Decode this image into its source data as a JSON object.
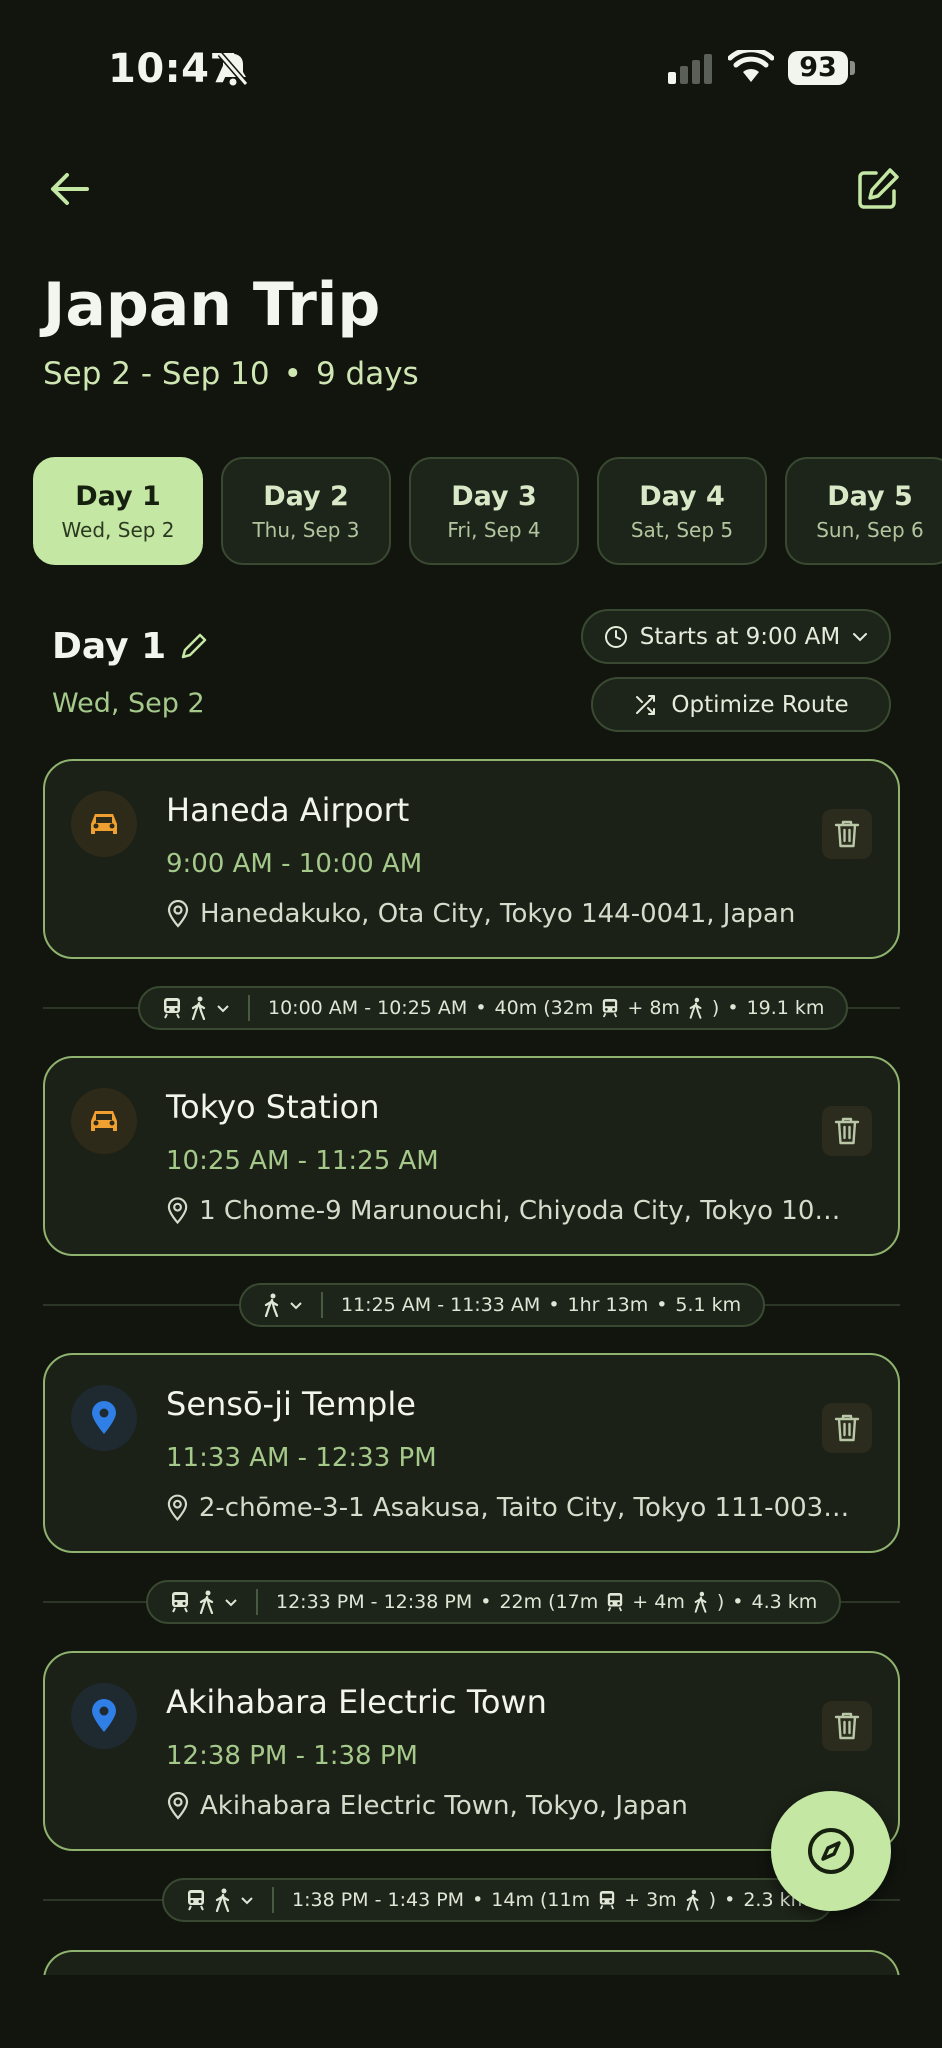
{
  "status_bar": {
    "time": "10:47",
    "battery": "93"
  },
  "trip": {
    "title": "Japan Trip",
    "date_range": "Sep 2 - Sep 10",
    "separator": "•",
    "duration": "9 days"
  },
  "day_tabs": [
    {
      "label": "Day 1",
      "date": "Wed, Sep 2"
    },
    {
      "label": "Day 2",
      "date": "Thu, Sep 3"
    },
    {
      "label": "Day 3",
      "date": "Fri, Sep 4"
    },
    {
      "label": "Day 4",
      "date": "Sat, Sep 5"
    },
    {
      "label": "Day 5",
      "date": "Sun, Sep 6"
    }
  ],
  "day": {
    "title": "Day 1",
    "date": "Wed, Sep 2",
    "starts_label": "Starts at 9:00 AM",
    "optimize_label": "Optimize Route"
  },
  "stops": [
    {
      "name": "Haneda Airport",
      "time": "9:00 AM - 10:00 AM",
      "address": "Hanedakuko, Ota City, Tokyo 144-0041, Japan",
      "icon": "car-icon"
    },
    {
      "name": "Tokyo Station",
      "time": "10:25 AM - 11:25 AM",
      "address": "1 Chome-9 Marunouchi, Chiyoda City, Tokyo 100-0...",
      "icon": "car-icon"
    },
    {
      "name": "Sensō-ji Temple",
      "time": "11:33 AM - 12:33 PM",
      "address": "2-chōme-3-1 Asakusa, Taito City, Tokyo 111-0032, J...",
      "icon": "location-pin-icon"
    },
    {
      "name": "Akihabara Electric Town",
      "time": "12:38 PM - 1:38 PM",
      "address": "Akihabara Electric Town, Tokyo, Japan",
      "icon": "location-pin-icon"
    }
  ],
  "connectors": [
    {
      "time": "10:00 AM - 10:25 AM",
      "duration_open": "40m (32m",
      "plus": "+ 8m",
      "close": ")",
      "distance": "19.1 km",
      "modes": [
        "train-icon",
        "walk-icon"
      ]
    },
    {
      "time": "11:25 AM - 11:33 AM",
      "duration": "1hr 13m",
      "distance": "5.1 km",
      "modes": [
        "walk-icon"
      ]
    },
    {
      "time": "12:33 PM - 12:38 PM",
      "duration_open": "22m (17m",
      "plus": "+ 4m",
      "close": ")",
      "distance": "4.3 km",
      "modes": [
        "train-icon",
        "walk-icon"
      ]
    },
    {
      "time": "1:38 PM - 1:43 PM",
      "duration_open": "14m (11m",
      "plus": "+ 3m",
      "close": ")",
      "distance": "2.3 km",
      "modes": [
        "train-icon",
        "walk-icon"
      ]
    }
  ],
  "colors": {
    "accent": "#c4e7a3",
    "background": "#11150e",
    "card_border": "#8fb36e",
    "car_orange": "#f0a030",
    "pin_blue": "#2f7fe6"
  }
}
